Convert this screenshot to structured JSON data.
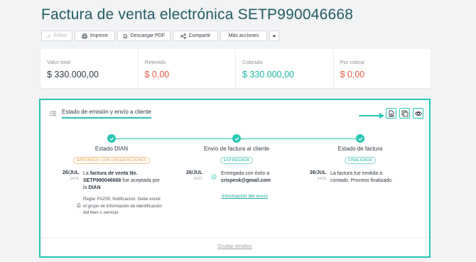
{
  "header": {
    "title": "Factura de venta electrónica SETP990046668"
  },
  "toolbar": {
    "edit_label": "Editar",
    "print_label": "Imprimir",
    "download_label": "Descargar PDF",
    "share_label": "Compartir",
    "more_label": "Más acciones"
  },
  "summary": [
    {
      "label": "Valor total",
      "value": "$ 330.000,00"
    },
    {
      "label": "Retenido",
      "value": "$ 0,00"
    },
    {
      "label": "Cobrado",
      "value": "$ 330.000,00"
    },
    {
      "label": "Por cobrar",
      "value": "$ 0,00"
    }
  ],
  "panel": {
    "title": "Estado de emisión y envío a cliente",
    "steps": [
      {
        "title": "Estado DIAN",
        "badge": "APROBADO CON OBSERVACIONES",
        "day": "26/JUL",
        "time": "14:16",
        "text_pre": "La ",
        "text_bold1": "factura de venta No. SETP990046668",
        "text_mid": " fue aceptada por la ",
        "text_bold2": "DIAN",
        "note": "Regla: FAZ09, Notificación: Debe existir el grupo de información de identificación del bien o servicio"
      },
      {
        "title": "Envío de factura al cliente",
        "badge": "ENTREGADA",
        "day": "26/JUL",
        "time": "14:22",
        "text_pre": "Entregada con éxito a ",
        "text_bold1": "crispesk@gmail.com",
        "link": "Información del envío"
      },
      {
        "title": "Estado de factura",
        "badge": "FINALIZADA",
        "day": "26/JUL",
        "time": "14:16",
        "text": "La factura fue emitida a contado. Proceso finalizado."
      }
    ],
    "hide_label": "Ocultar detalles"
  },
  "colors": {
    "accent": "#26c5b3",
    "title": "#1f5c63",
    "negative": "#e8573f",
    "positive": "#19b7a6",
    "warning": "#e59a3a"
  },
  "icons": [
    "pencil-icon",
    "printer-icon",
    "pdf-icon",
    "share-icon",
    "caret-down-icon",
    "list-icon",
    "arrow-right-icon",
    "document-icon",
    "copy-icon",
    "eye-icon",
    "check-icon",
    "bell-icon",
    "check-circle-icon"
  ]
}
